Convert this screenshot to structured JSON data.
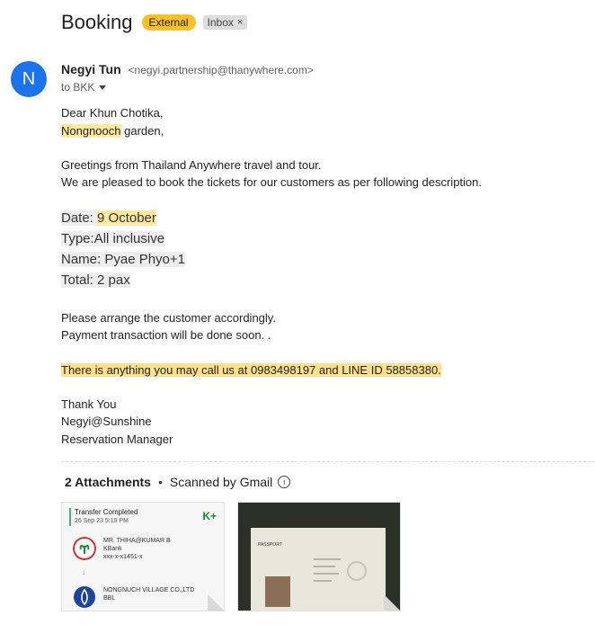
{
  "subject": "Booking",
  "labels": {
    "external": "External",
    "inbox": "Inbox",
    "inbox_remove": "×"
  },
  "sender": {
    "avatar_letter": "N",
    "name": "Negyi Tun",
    "email": "<negyi.partnership@thanywhere.com>",
    "to": "to BKK"
  },
  "body": {
    "greeting": "Dear Khun Chotika,",
    "recipient_hl": "Nongnooch",
    "recipient_rest": " garden,",
    "line1": "Greetings from Thailand Anywhere travel and tour.",
    "line2": "We are pleased to book the tickets for our customers as per following description.",
    "date_label": "Date: ",
    "date_value": "9 October",
    "type": "Type:All inclusive",
    "name": "Name: Pyae Phyo+1",
    "total": "Total: 2 pax",
    "arrange": "Please arrange the customer accordingly.",
    "payment": "Payment transaction will be done soon.  .",
    "contact": "There is anything you may call us at 0983498197 and LINE ID 58858380.",
    "thanks": "Thank You",
    "signature": "Negyi@Sunshine",
    "role": "Reservation Manager"
  },
  "attachments": {
    "count_label": "2 Attachments",
    "dot": "•",
    "scanned": "Scanned by Gmail",
    "info_glyph": "i",
    "transfer": {
      "title": "Transfer Completed",
      "date": "26 Sep 23  5:19 PM",
      "brand": "K+",
      "from_name": "MR. THIHA@KUMAR B",
      "from_bank": "KBank",
      "from_acct": "xxx-x-x1451-x",
      "arrow": "↓",
      "to_name": "NONGNUCH VILLAGE CO.,LTD",
      "to_bank": "BBL"
    },
    "passport": {
      "label": "PASSPORT"
    }
  },
  "colors": {
    "avatar": "#1a73e8",
    "external_label": "#f6c026",
    "highlight": "#ffe8a0",
    "kbank_green": "#138f2d",
    "bbl_blue": "#1e4598"
  }
}
